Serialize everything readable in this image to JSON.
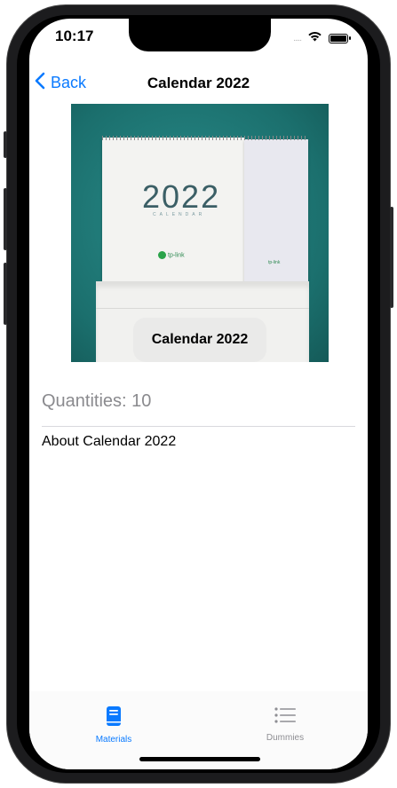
{
  "status_bar": {
    "time": "10:17",
    "signal": ".....",
    "icons": [
      "wifi-icon",
      "battery-icon"
    ]
  },
  "nav": {
    "back_label": "Back",
    "title": "Calendar 2022"
  },
  "hero": {
    "caption": "Calendar 2022",
    "calendar_year": "2022",
    "calendar_word": "CALENDAR",
    "brand": "tp-link"
  },
  "content": {
    "quantities": "Quantities: 10",
    "about": "About Calendar 2022"
  },
  "tabbar": {
    "tabs": [
      {
        "label": "Materials",
        "icon": "book-icon",
        "selected": true
      },
      {
        "label": "Dummies",
        "icon": "list-icon",
        "selected": false
      }
    ]
  },
  "colors": {
    "accent": "#0a7aff",
    "tab_inactive": "#8e8e93",
    "secondary_text": "#8a8a8e"
  }
}
